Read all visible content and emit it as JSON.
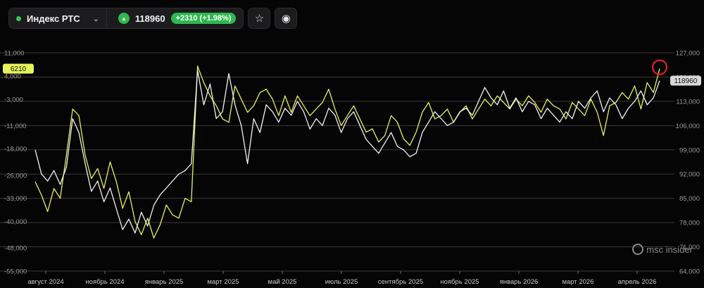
{
  "toolbar": {
    "index_name": "Индекс РТС",
    "price": "118960",
    "change": "+2310 (+1.98%)",
    "up_arrow": "▲",
    "chevron": "⌄",
    "star_icon": "☆",
    "eye_icon": "◉"
  },
  "colors": {
    "background": "#050505",
    "grid": "#3a3a3a",
    "left_series": "#e4f35a",
    "right_series": "#f2f2f2",
    "positive": "#2fb84f",
    "marker": "#e0202a"
  },
  "left_badge": "6210",
  "right_badge": "118960",
  "logo_text": "msc insider",
  "chart_data": {
    "type": "line",
    "title": "",
    "y_left_ticks": [
      "11,000",
      "4,000",
      "-3,000",
      "-11,000",
      "-18,000",
      "-26,000",
      "-33,000",
      "-40,000",
      "-48,000",
      "-55,000"
    ],
    "y_left_range": [
      -55000,
      11000
    ],
    "y_right_ticks": [
      "127,000",
      "120,000",
      "113,000",
      "106,000",
      "99,000",
      "92,000",
      "85,000",
      "78,000",
      "71,000",
      "64,000"
    ],
    "y_right_range": [
      64000,
      127000
    ],
    "x_labels": [
      "август 2024",
      "ноябрь 2024",
      "январь 2025",
      "март 2025",
      "май 2025",
      "июль 2025",
      "сентябрь 2025",
      "ноябрь 2025",
      "январь 2026",
      "март 2026",
      "апрель 2026"
    ],
    "grid": true,
    "series": [
      {
        "axis": "left",
        "x": [
          0,
          1,
          2,
          3,
          4,
          5,
          6,
          7,
          8,
          9,
          10,
          11,
          12,
          13,
          14,
          15,
          16,
          17,
          18,
          19,
          20,
          21,
          22,
          23,
          24,
          25,
          26,
          27,
          28,
          29,
          30,
          31,
          32,
          33,
          34,
          35,
          36,
          37,
          38,
          39,
          40,
          41,
          42,
          43,
          44,
          45,
          46,
          47,
          48,
          49,
          50,
          51,
          52,
          53,
          54,
          55,
          56,
          57,
          58,
          59,
          60,
          61,
          62,
          63,
          64,
          65,
          66,
          67,
          68,
          69,
          70,
          71,
          72,
          73,
          74,
          75,
          76,
          77,
          78,
          79,
          80,
          81,
          82,
          83,
          84,
          85,
          86,
          87,
          88,
          89,
          90,
          91,
          92,
          93,
          94,
          95,
          96,
          97,
          98,
          99,
          100
        ],
        "values": [
          -28000,
          -32000,
          -37000,
          -30000,
          -33000,
          -20000,
          -6000,
          -8000,
          -20000,
          -27000,
          -24000,
          -30000,
          -22000,
          -28000,
          -36000,
          -31000,
          -40000,
          -44000,
          -39000,
          -45000,
          -41000,
          -35000,
          -38000,
          -39000,
          -33000,
          -34000,
          7000,
          2000,
          -2000,
          -5000,
          -9000,
          -10000,
          1000,
          -3000,
          -7000,
          -5000,
          -1000,
          0,
          -3000,
          -8000,
          -2000,
          -7000,
          -2000,
          -5000,
          -8000,
          -6000,
          -4000,
          0,
          -6000,
          -11000,
          -8000,
          -5000,
          -9000,
          -13000,
          -12000,
          -16000,
          -14000,
          -8000,
          -10000,
          -15000,
          -17000,
          -13000,
          -7000,
          -4000,
          -9000,
          -8000,
          -6000,
          -10000,
          -7000,
          -5000,
          -9000,
          -6000,
          -3000,
          -5000,
          -2000,
          -4000,
          -6000,
          -3000,
          -5000,
          -2000,
          -4000,
          -7000,
          -3000,
          -5000,
          -6000,
          -9000,
          -4000,
          -6000,
          -8000,
          -3000,
          -7000,
          -14000,
          -5000,
          -4000,
          -1000,
          -3000,
          1000,
          -6000,
          2000,
          -1000,
          6210
        ]
      },
      {
        "axis": "right",
        "x": [
          0,
          1,
          2,
          3,
          4,
          5,
          6,
          7,
          8,
          9,
          10,
          11,
          12,
          13,
          14,
          15,
          16,
          17,
          18,
          19,
          20,
          21,
          22,
          23,
          24,
          25,
          26,
          27,
          28,
          29,
          30,
          31,
          32,
          33,
          34,
          35,
          36,
          37,
          38,
          39,
          40,
          41,
          42,
          43,
          44,
          45,
          46,
          47,
          48,
          49,
          50,
          51,
          52,
          53,
          54,
          55,
          56,
          57,
          58,
          59,
          60,
          61,
          62,
          63,
          64,
          65,
          66,
          67,
          68,
          69,
          70,
          71,
          72,
          73,
          74,
          75,
          76,
          77,
          78,
          79,
          80,
          81,
          82,
          83,
          84,
          85,
          86,
          87,
          88,
          89,
          90,
          91,
          92,
          93,
          94,
          95,
          96,
          97,
          98,
          99,
          100
        ],
        "values": [
          99000,
          92000,
          90000,
          93000,
          89000,
          94000,
          108000,
          104000,
          95000,
          87000,
          90000,
          84000,
          88000,
          82000,
          76000,
          79000,
          75000,
          81000,
          77000,
          83000,
          86000,
          88000,
          90000,
          92000,
          93000,
          95000,
          122000,
          112000,
          118000,
          108000,
          110000,
          121000,
          112000,
          106000,
          95000,
          108000,
          104000,
          112000,
          110000,
          107000,
          111000,
          109000,
          113000,
          110000,
          105000,
          108000,
          106000,
          111000,
          109000,
          104000,
          108000,
          110000,
          106000,
          102000,
          100000,
          98000,
          101000,
          104000,
          100000,
          99000,
          97000,
          98000,
          104000,
          107000,
          110000,
          108000,
          106000,
          107000,
          110000,
          111000,
          109000,
          113000,
          117000,
          114000,
          112000,
          116000,
          111000,
          114000,
          110000,
          113000,
          112000,
          108000,
          111000,
          109000,
          107000,
          110000,
          108000,
          113000,
          111000,
          114000,
          116000,
          110000,
          114000,
          112000,
          108000,
          111000,
          113000,
          116000,
          112000,
          114000,
          118960
        ]
      }
    ],
    "marker": {
      "series": "left",
      "index": 100
    }
  }
}
